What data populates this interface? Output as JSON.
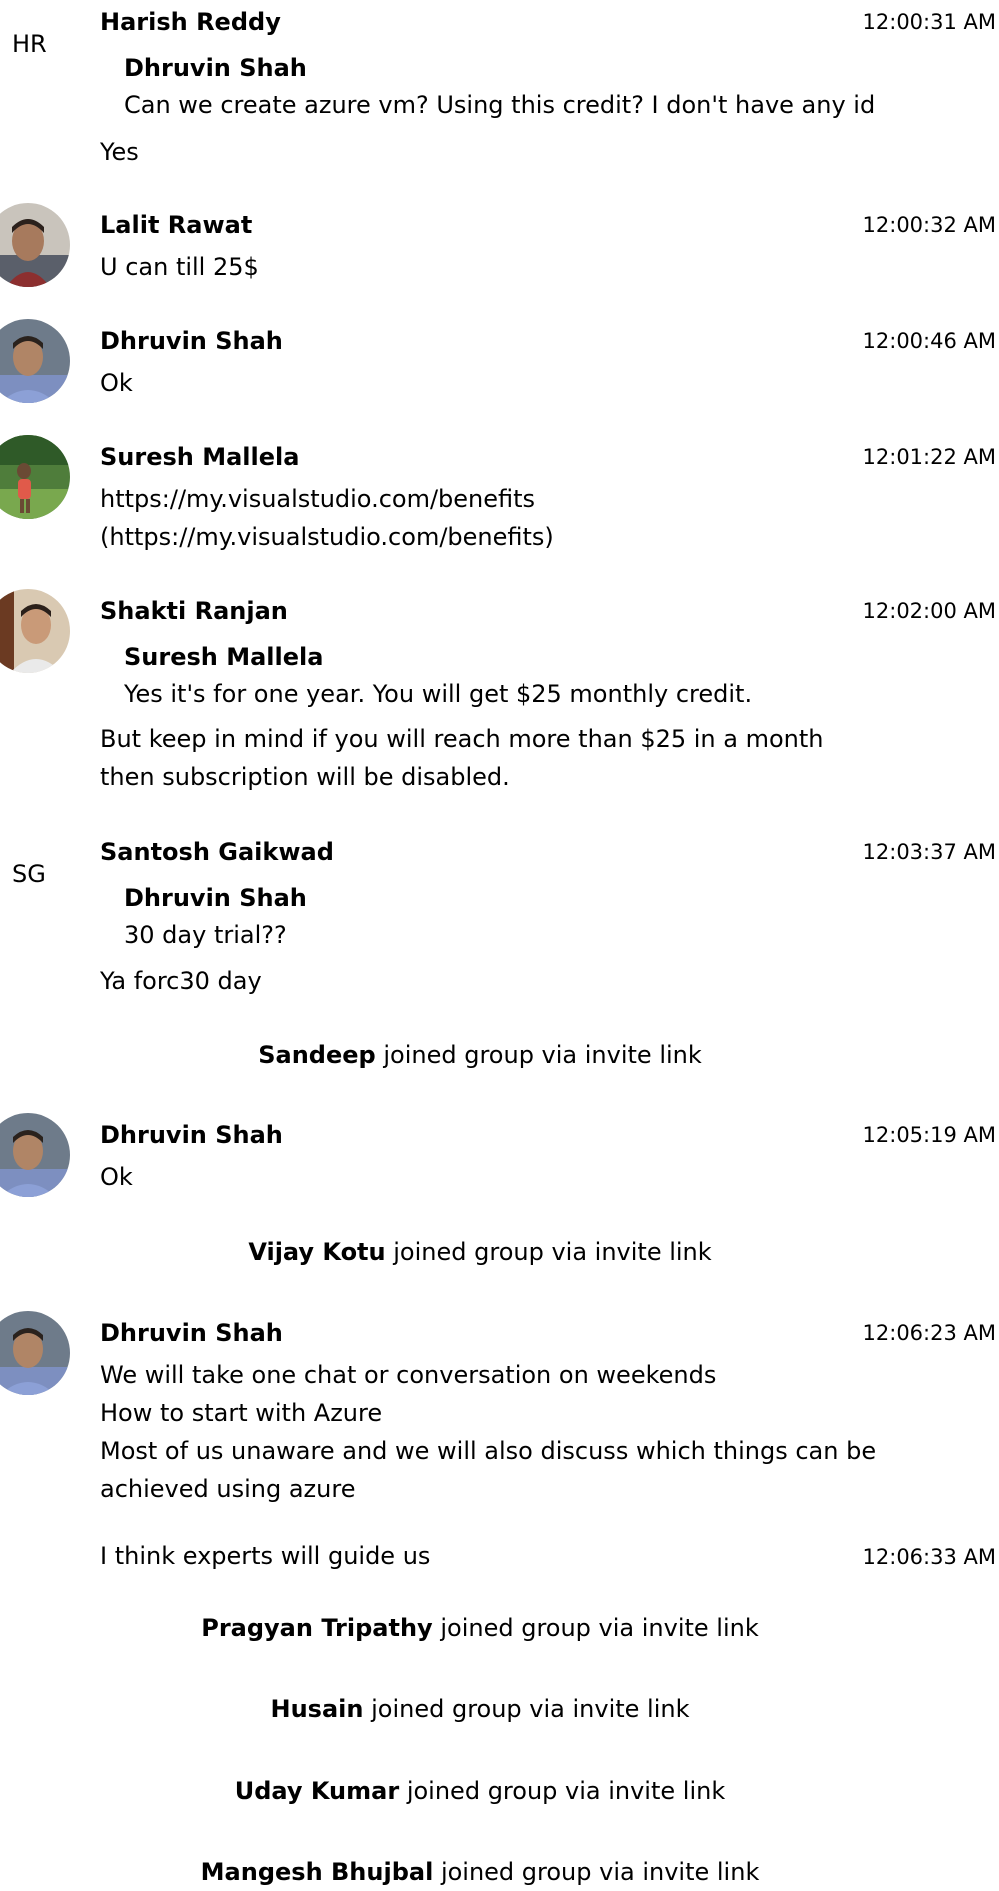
{
  "messages": {
    "m1": {
      "initials": "HR",
      "sender": "Harish Reddy",
      "time": "12:00:31 AM",
      "quote_name": "Dhruvin Shah",
      "quote_text": "Can we create azure vm? Using this credit? I don't have any id",
      "text": "Yes"
    },
    "m2": {
      "sender": "Lalit Rawat",
      "time": "12:00:32 AM",
      "text": "U can till 25$"
    },
    "m3": {
      "sender": "Dhruvin Shah",
      "time": "12:00:46 AM",
      "text": "Ok"
    },
    "m4": {
      "sender": "Suresh Mallela",
      "time": "12:01:22 AM",
      "line1": "https://my.visualstudio.com/benefits",
      "line2": "(https://my.visualstudio.com/benefits)"
    },
    "m5": {
      "sender": "Shakti Ranjan",
      "time": "12:02:00 AM",
      "quote_name": "Suresh Mallela",
      "quote_text": "Yes it's for one year. You will get $25 monthly credit.",
      "line1": "But keep in mind if you will reach more than $25 in a month",
      "line2": "then subscription will be disabled."
    },
    "m6": {
      "initials": "SG",
      "sender": "Santosh Gaikwad",
      "time": "12:03:37 AM",
      "quote_name": "Dhruvin Shah",
      "quote_text": "30 day trial??",
      "text": "Ya forc30 day"
    },
    "m7": {
      "sender": "Dhruvin Shah",
      "time": "12:05:19 AM",
      "text": "Ok"
    },
    "m8": {
      "sender": "Dhruvin Shah",
      "time": "12:06:23 AM",
      "line1": "We will take one chat or conversation on weekends",
      "line2": "How to start with Azure",
      "line3": "Most of us unaware and we will also discuss which things can be",
      "line4": "achieved using azure",
      "followup_text": "I think experts will guide us",
      "followup_time": "12:06:33 AM"
    }
  },
  "system": {
    "s1": {
      "name": "Sandeep",
      "action": "joined group via invite link"
    },
    "s2": {
      "name": "Vijay Kotu",
      "action": "joined group via invite link"
    },
    "s3": {
      "name": "Pragyan Tripathy",
      "action": "joined group via invite link"
    },
    "s4": {
      "name": "Husain",
      "action": "joined group via invite link"
    },
    "s5": {
      "name": "Uday Kumar",
      "action": "joined group via invite link"
    },
    "s6": {
      "name": "Mangesh Bhujbal",
      "action": "joined group via invite link"
    }
  }
}
